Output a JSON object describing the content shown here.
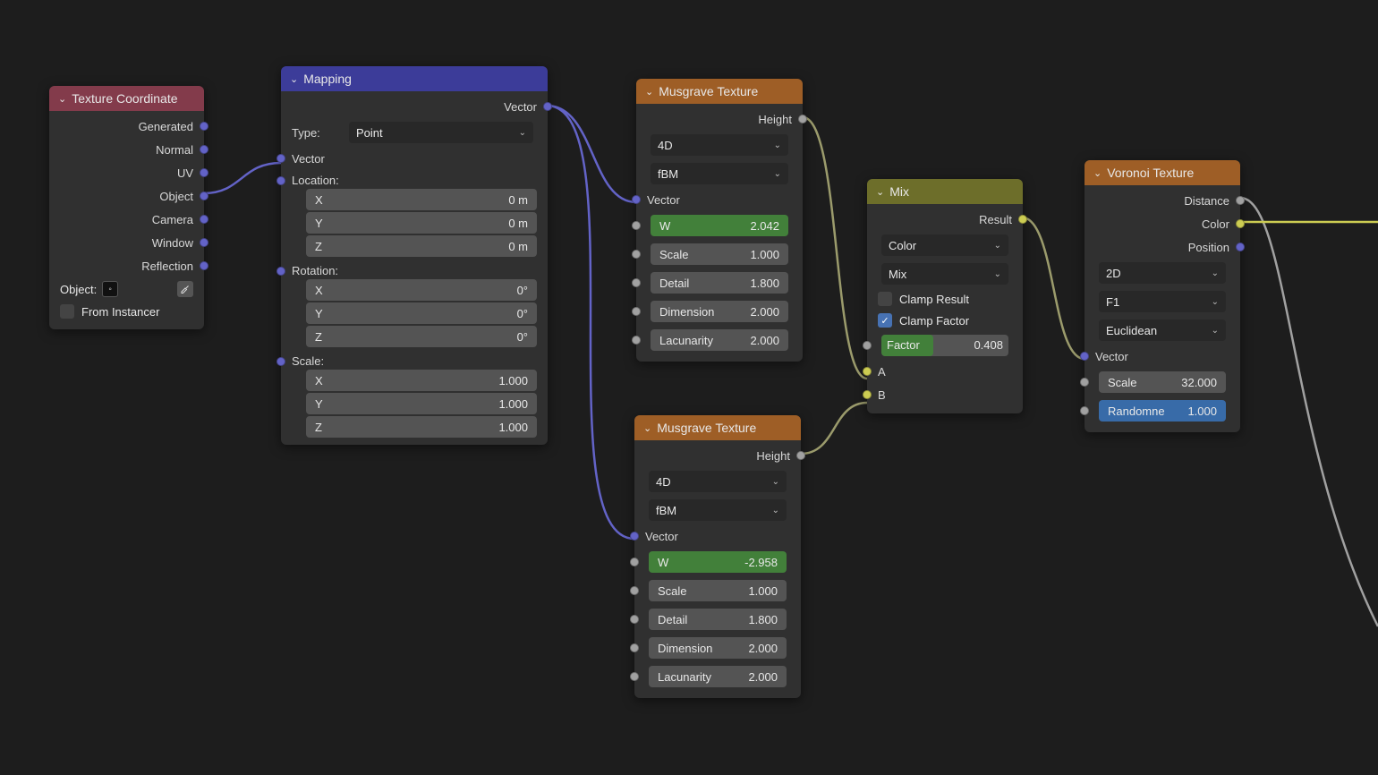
{
  "texcoord": {
    "title": "Texture Coordinate",
    "outputs": [
      "Generated",
      "Normal",
      "UV",
      "Object",
      "Camera",
      "Window",
      "Reflection"
    ],
    "object_label": "Object:",
    "from_instancer": "From Instancer"
  },
  "mapping": {
    "title": "Mapping",
    "vector_out": "Vector",
    "type_label": "Type:",
    "type_value": "Point",
    "vector_in": "Vector",
    "location_label": "Location:",
    "location": {
      "x_label": "X",
      "x_val": "0 m",
      "y_label": "Y",
      "y_val": "0 m",
      "z_label": "Z",
      "z_val": "0 m"
    },
    "rotation_label": "Rotation:",
    "rotation": {
      "x_label": "X",
      "x_val": "0°",
      "y_label": "Y",
      "y_val": "0°",
      "z_label": "Z",
      "z_val": "0°"
    },
    "scale_label": "Scale:",
    "scale": {
      "x_label": "X",
      "x_val": "1.000",
      "y_label": "Y",
      "y_val": "1.000",
      "z_label": "Z",
      "z_val": "1.000"
    }
  },
  "musgrave1": {
    "title": "Musgrave Texture",
    "height": "Height",
    "dim": "4D",
    "type": "fBM",
    "vector": "Vector",
    "w_label": "W",
    "w_val": "2.042",
    "scale_label": "Scale",
    "scale_val": "1.000",
    "detail_label": "Detail",
    "detail_val": "1.800",
    "dimension_label": "Dimension",
    "dimension_val": "2.000",
    "lacunarity_label": "Lacunarity",
    "lacunarity_val": "2.000"
  },
  "musgrave2": {
    "title": "Musgrave Texture",
    "height": "Height",
    "dim": "4D",
    "type": "fBM",
    "vector": "Vector",
    "w_label": "W",
    "w_val": "-2.958",
    "scale_label": "Scale",
    "scale_val": "1.000",
    "detail_label": "Detail",
    "detail_val": "1.800",
    "dimension_label": "Dimension",
    "dimension_val": "2.000",
    "lacunarity_label": "Lacunarity",
    "lacunarity_val": "2.000"
  },
  "mix": {
    "title": "Mix",
    "result": "Result",
    "datatype": "Color",
    "blend": "Mix",
    "clamp_result": "Clamp Result",
    "clamp_factor": "Clamp Factor",
    "factor_label": "Factor",
    "factor_val": "0.408",
    "a": "A",
    "b": "B"
  },
  "voronoi": {
    "title": "Voronoi Texture",
    "distance_out": "Distance",
    "color_out": "Color",
    "position_out": "Position",
    "dim": "2D",
    "feature": "F1",
    "metric": "Euclidean",
    "vector": "Vector",
    "scale_label": "Scale",
    "scale_val": "32.000",
    "random_label": "Randomne",
    "random_val": "1.000"
  }
}
